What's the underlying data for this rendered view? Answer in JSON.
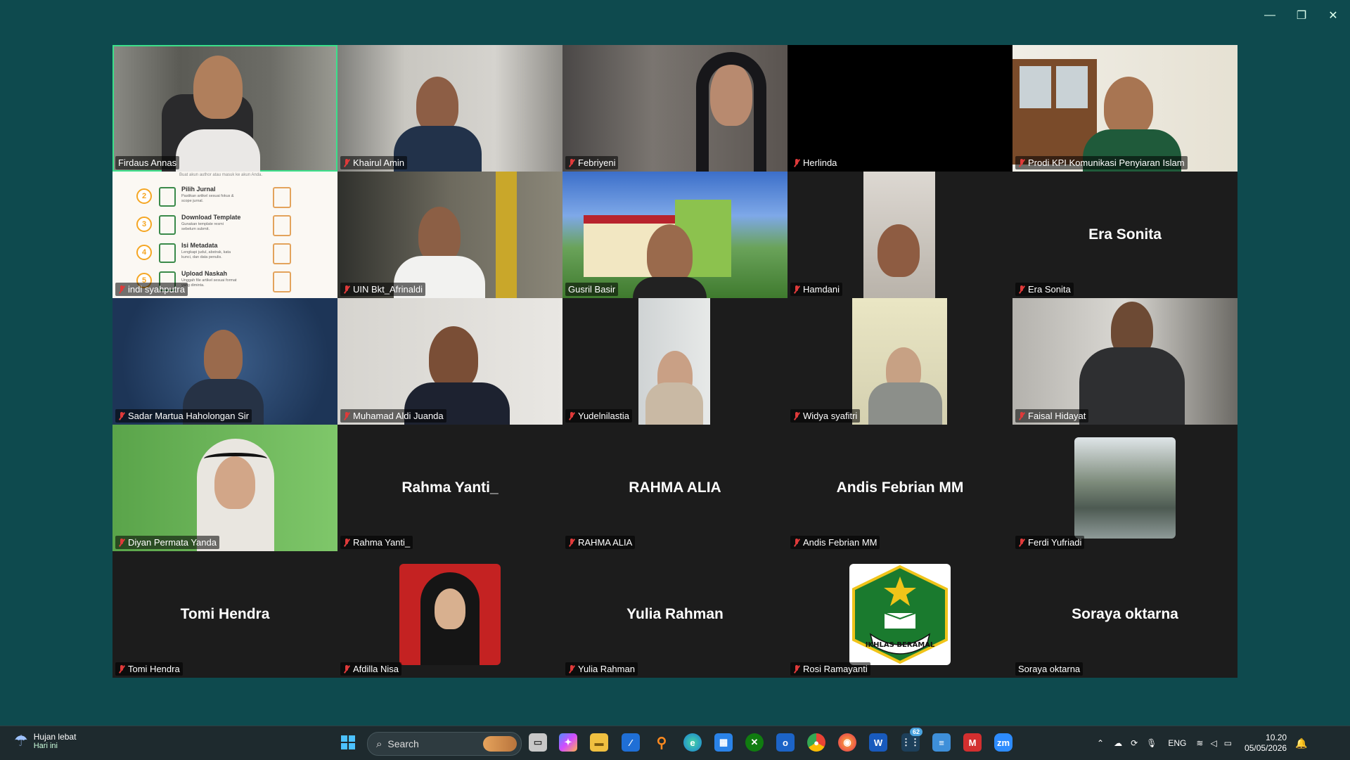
{
  "window": {
    "minimize": "—",
    "restore": "❐",
    "close": "✕"
  },
  "tiles": [
    {
      "name": "Firdaus Annas",
      "muted": false,
      "active": true,
      "kind": "video"
    },
    {
      "name": "Khairul Amin",
      "muted": true,
      "kind": "video"
    },
    {
      "name": "Febriyeni",
      "muted": true,
      "kind": "video"
    },
    {
      "name": "Herlinda",
      "muted": true,
      "kind": "black"
    },
    {
      "name": "Prodi KPI Komunikasi Penyiaran Islam",
      "muted": true,
      "kind": "video"
    },
    {
      "name": "indi syahputra",
      "muted": true,
      "kind": "screen"
    },
    {
      "name": "UIN Bkt_Afrinaldi",
      "muted": true,
      "kind": "video"
    },
    {
      "name": "Gusril Basir",
      "muted": false,
      "kind": "video"
    },
    {
      "name": "Hamdani",
      "muted": true,
      "kind": "video"
    },
    {
      "name": "Era Sonita",
      "muted": true,
      "kind": "label",
      "label": "Era Sonita"
    },
    {
      "name": "Sadar Martua Haholongan Sir",
      "muted": true,
      "kind": "video"
    },
    {
      "name": "Muhamad Aldi Juanda",
      "muted": true,
      "kind": "video"
    },
    {
      "name": "Yudelnilastia",
      "muted": true,
      "kind": "video"
    },
    {
      "name": "Widya syafitri",
      "muted": true,
      "kind": "video"
    },
    {
      "name": "Faisal Hidayat",
      "muted": true,
      "kind": "video"
    },
    {
      "name": "Diyan Permata Yanda",
      "muted": true,
      "kind": "video"
    },
    {
      "name": "Rahma Yanti_",
      "muted": true,
      "kind": "label",
      "label": "Rahma Yanti_"
    },
    {
      "name": "RAHMA ALIA",
      "muted": true,
      "kind": "label",
      "label": "RAHMA ALIA"
    },
    {
      "name": "Andis Febrian MM",
      "muted": true,
      "kind": "label",
      "label": "Andis Febrian MM"
    },
    {
      "name": "Ferdi Yufriadi",
      "muted": true,
      "kind": "avatar"
    },
    {
      "name": "Tomi Hendra",
      "muted": true,
      "kind": "label",
      "label": "Tomi Hendra"
    },
    {
      "name": "Afdilla Nisa",
      "muted": true,
      "kind": "avatar"
    },
    {
      "name": "Yulia Rahman",
      "muted": true,
      "kind": "label",
      "label": "Yulia Rahman"
    },
    {
      "name": "Rosi Ramayanti",
      "muted": true,
      "kind": "avatar"
    },
    {
      "name": "Soraya oktarna",
      "muted": false,
      "kind": "label",
      "label": "Soraya oktarna"
    }
  ],
  "screenshare": {
    "steps": [
      {
        "num": "2",
        "title": "Pilih Jurnal",
        "desc": "Pastikan artikel sesuai fokus & scope jurnal."
      },
      {
        "num": "3",
        "title": "Download Template",
        "desc": "Gunakan template resmi sebelum submit."
      },
      {
        "num": "4",
        "title": "Isi Metadata",
        "desc": "Lengkapi judul, abstrak, kata kunci, dan data penulis."
      },
      {
        "num": "5",
        "title": "Upload Naskah",
        "desc": "Unggah file artikel sesuai format yang diminta."
      }
    ],
    "top_text": "Buat akun author atau masuk ke akun Anda."
  },
  "logo_text": "IKHLAS BERAMAL",
  "taskbar": {
    "weather_title": "Hujan lebat",
    "weather_sub": "Hari ini",
    "search_placeholder": "Search",
    "badge": "62",
    "lang": "ENG",
    "time": "10.20",
    "date": "05/05/2026"
  },
  "colors": {
    "active_border": "#3be08a",
    "muted_icon": "#e03a3a",
    "background": "#0e4a4e"
  }
}
